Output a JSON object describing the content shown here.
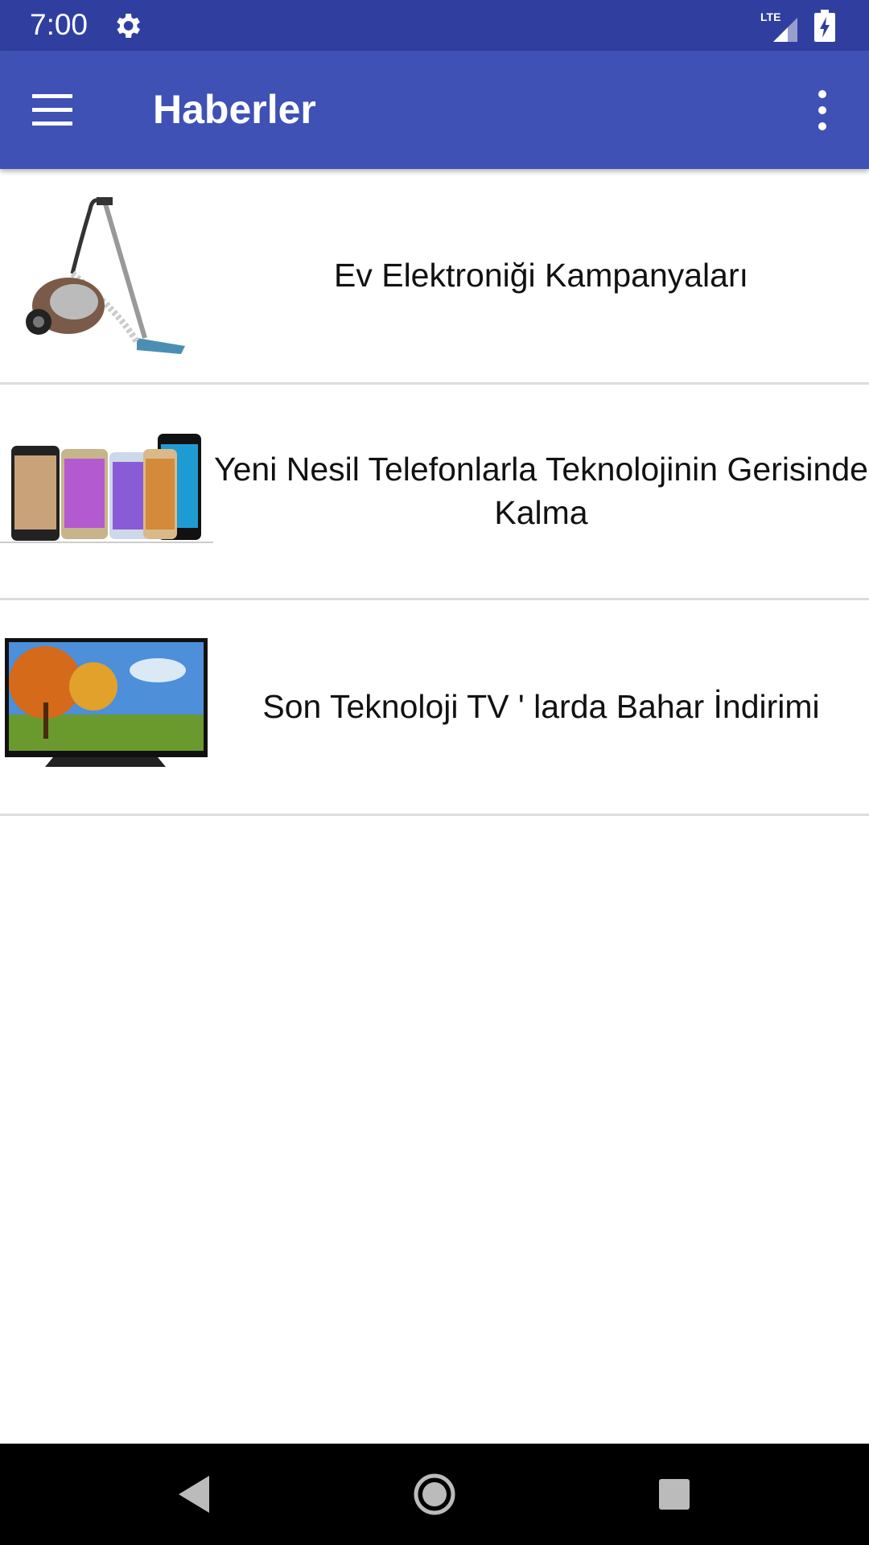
{
  "status_bar": {
    "time": "7:00",
    "network": "LTE",
    "icons": [
      "settings-gear-icon",
      "lte-signal-icon",
      "battery-charging-icon"
    ]
  },
  "toolbar": {
    "title": "Haberler",
    "menu_icon": "hamburger-menu-icon",
    "overflow_icon": "more-vert-icon",
    "color": "#3f51b5"
  },
  "news": [
    {
      "title": "Ev Elektroniği Kampanyaları",
      "image": "vacuum-cleaner"
    },
    {
      "title": "Yeni Nesil Telefonlarla Teknolojinin Gerisinde Kalma",
      "image": "smartphones"
    },
    {
      "title": "Son Teknoloji TV ' larda Bahar İndirimi",
      "image": "television"
    }
  ],
  "nav_bar": {
    "icons": [
      "back-icon",
      "home-icon",
      "recents-icon"
    ]
  }
}
